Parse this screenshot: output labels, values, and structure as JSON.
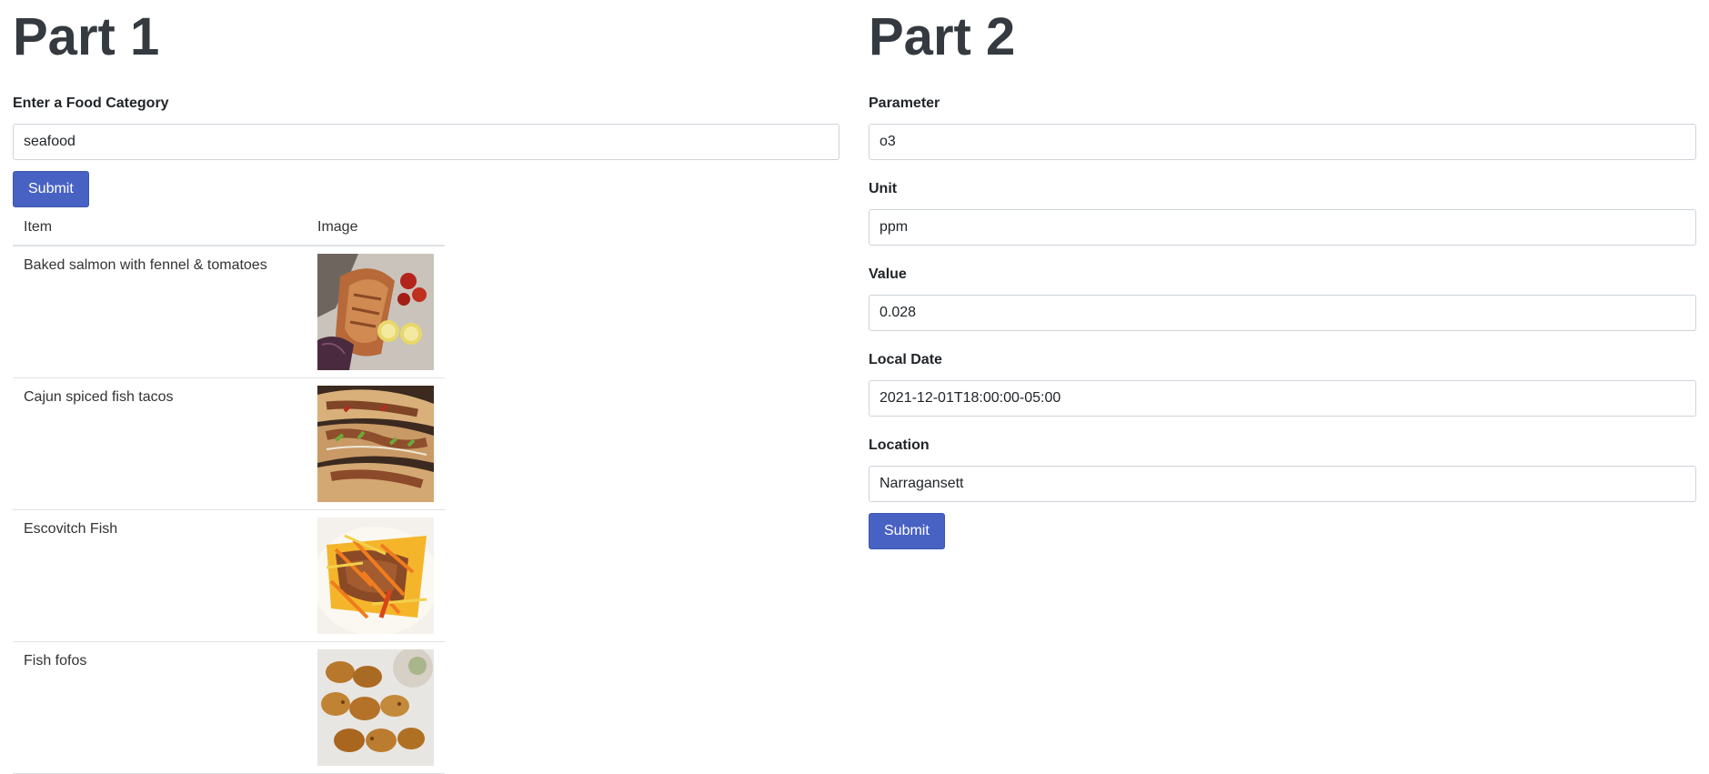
{
  "part1": {
    "title": "Part 1",
    "category_label": "Enter a Food Category",
    "category_value": "seafood",
    "submit_label": "Submit",
    "table": {
      "headers": [
        "Item",
        "Image"
      ],
      "rows": [
        {
          "item": "Baked salmon with fennel & tomatoes",
          "image": "baked-salmon-photo"
        },
        {
          "item": "Cajun spiced fish tacos",
          "image": "fish-tacos-photo"
        },
        {
          "item": "Escovitch Fish",
          "image": "escovitch-fish-photo"
        },
        {
          "item": "Fish fofos",
          "image": "fish-fofos-photo"
        }
      ]
    }
  },
  "part2": {
    "title": "Part 2",
    "fields": [
      {
        "label": "Parameter",
        "value": "o3"
      },
      {
        "label": "Unit",
        "value": "ppm"
      },
      {
        "label": "Value",
        "value": "0.028"
      },
      {
        "label": "Local Date",
        "value": "2021-12-01T18:00:00-05:00"
      },
      {
        "label": "Location",
        "value": "Narragansett"
      }
    ],
    "submit_label": "Submit"
  }
}
